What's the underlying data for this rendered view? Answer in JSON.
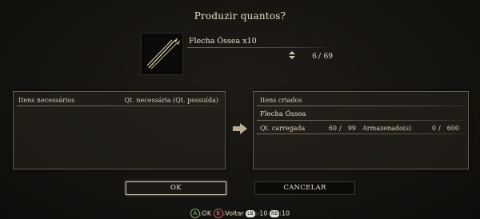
{
  "dialog": {
    "title": "Produzir quantos?",
    "item_name": "Flecha Óssea x10",
    "qty_current": "6",
    "qty_max": "69"
  },
  "left_panel": {
    "header_left": "Itens necessários",
    "header_right": "Qt. necessária (Qt. possuída)"
  },
  "right_panel": {
    "header": "Itens criados",
    "item": "Flecha Óssea",
    "carried_label": "Qt. carregada",
    "carried_value": "60",
    "carried_max": "99",
    "stored_label": "Armazenado(s)",
    "stored_value": "0",
    "stored_max": "600"
  },
  "buttons": {
    "ok": "OK",
    "cancel": "CANCELAR"
  },
  "hints": {
    "a_key": "A",
    "ok": ":OK",
    "b_key": "B",
    "back": ":Voltar",
    "lb_key": "LB",
    "lb_value": ":-10",
    "rb_key": "RB",
    "rb_value": ":10"
  },
  "icons": {
    "item_thumbnail": "bone-arrow-icon",
    "quantity": "up-down-arrow-icon",
    "transfer": "right-arrow-icon"
  }
}
